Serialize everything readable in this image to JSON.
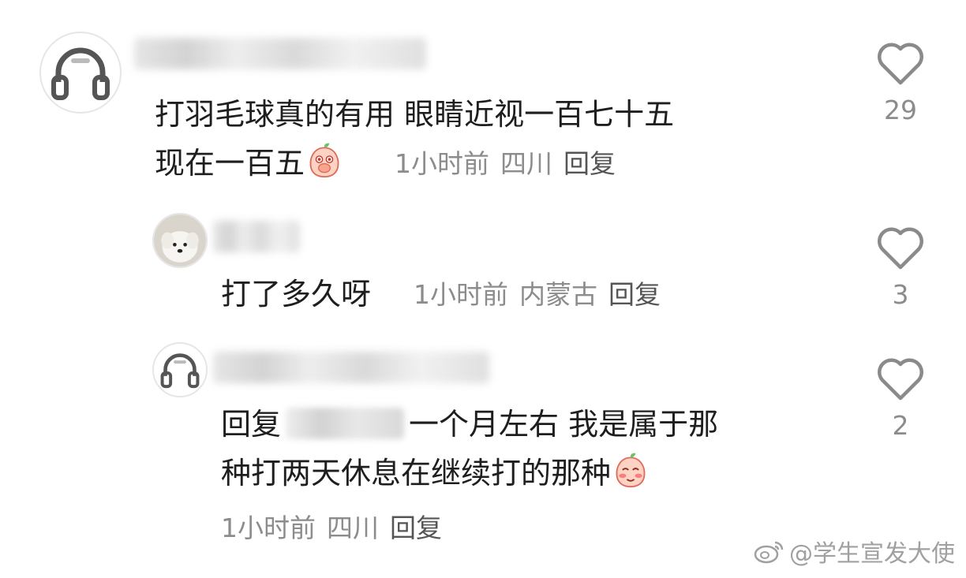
{
  "comments": [
    {
      "avatar_icon": "headphones-icon",
      "text_line1": "打羽毛球真的有用 眼睛近视一百七十五",
      "text_line2": "现在一百五",
      "emoji": "peach-covering-mouth-emoji",
      "time": "1小时前",
      "location": "四川",
      "reply_label": "回复",
      "likes": "29"
    },
    {
      "avatar_icon": "white-dog-avatar",
      "text_line1": "打了多久呀",
      "time": "1小时前",
      "location": "内蒙古",
      "reply_label": "回复",
      "likes": "3"
    },
    {
      "avatar_icon": "headphones-icon",
      "reply_prefix": "回复",
      "text_line1_rest": "一个月左右 我是属于那",
      "text_line2": "种打两天休息在继续打的那种",
      "emoji": "peach-blushing-emoji",
      "time": "1小时前",
      "location": "四川",
      "reply_label": "回复",
      "likes": "2"
    }
  ],
  "watermark": {
    "text": "@学生宣发大使",
    "icon": "weibo-icon"
  },
  "colors": {
    "text": "#1e1e1e",
    "meta": "#8c8c8c",
    "heart_outline": "#8a8a8a"
  }
}
